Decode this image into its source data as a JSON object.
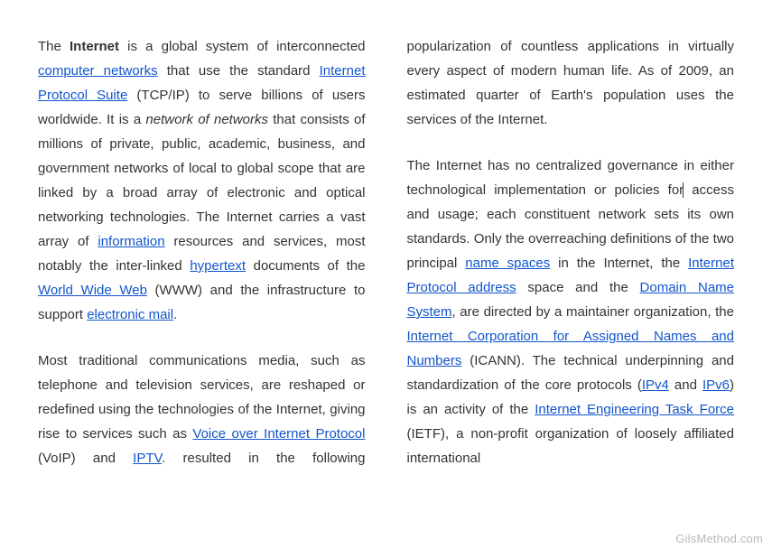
{
  "document": {
    "paragraphs": [
      [
        {
          "t": "The ",
          "s": ""
        },
        {
          "t": "Internet",
          "s": "bold"
        },
        {
          "t": " is a global system of interconnected ",
          "s": ""
        },
        {
          "t": "computer networks",
          "s": "link",
          "name": "link-computer-networks"
        },
        {
          "t": " that use the standard ",
          "s": ""
        },
        {
          "t": "Internet Protocol Suite",
          "s": "link",
          "name": "link-internet-protocol-suite"
        },
        {
          "t": " (TCP/IP) to serve billions of users worldwide. It is a ",
          "s": ""
        },
        {
          "t": "network of networks",
          "s": "italic"
        },
        {
          "t": " that consists of millions of private, public, academic, business, and government networks of local to global scope that are linked by a broad array of electronic and optical networking technologies. The Internet carries a vast array of ",
          "s": ""
        },
        {
          "t": "information",
          "s": "link",
          "name": "link-information"
        },
        {
          "t": " resources and services, most notably the inter-linked ",
          "s": ""
        },
        {
          "t": "hypertext",
          "s": "link",
          "name": "link-hypertext"
        },
        {
          "t": " documents of the ",
          "s": ""
        },
        {
          "t": "World Wide Web",
          "s": "link",
          "name": "link-world-wide-web"
        },
        {
          "t": " (WWW) and the infrastructure to support ",
          "s": ""
        },
        {
          "t": "electronic mail",
          "s": "link",
          "name": "link-electronic-mail"
        },
        {
          "t": ".",
          "s": ""
        }
      ],
      [
        {
          "t": "Most traditional communications media, such as telephone and television services, are reshaped or redefined using the technologies of the Internet, giving rise to services such as ",
          "s": ""
        },
        {
          "t": "Voice over Internet Protocol",
          "s": "link",
          "name": "link-voip"
        },
        {
          "t": " (VoIP) and ",
          "s": ""
        },
        {
          "t": "IPTV",
          "s": "link",
          "name": "link-iptv"
        },
        {
          "t": ". ",
          "s": ""
        },
        {
          "t": "resulted in the following popularization of countless applications in virtually every aspect of modern human life. As of 2009, an estimated quarter of Earth's population uses the services of the Internet.",
          "s": ""
        }
      ],
      [
        {
          "t": "The Internet has no centralized governance in either technological implementation or policies for",
          "s": ""
        },
        {
          "t": "",
          "s": "caret"
        },
        {
          "t": " access and usage; each constituent network sets its own standards. Only the overreaching definitions of the two principal ",
          "s": ""
        },
        {
          "t": "name spaces",
          "s": "link",
          "name": "link-name-spaces"
        },
        {
          "t": " in the Internet, the ",
          "s": ""
        },
        {
          "t": "Internet Protocol address",
          "s": "link",
          "name": "link-ip-address"
        },
        {
          "t": " space and the ",
          "s": ""
        },
        {
          "t": "Domain Name System",
          "s": "link",
          "name": "link-dns"
        },
        {
          "t": ", are directed by a maintainer organization, the ",
          "s": ""
        },
        {
          "t": "Internet Corporation for Assigned Names and Numbers",
          "s": "link",
          "name": "link-icann"
        },
        {
          "t": " (ICANN). The technical underpinning and standardization of the core protocols (",
          "s": ""
        },
        {
          "t": "IPv4",
          "s": "link",
          "name": "link-ipv4"
        },
        {
          "t": " and ",
          "s": ""
        },
        {
          "t": "IPv6",
          "s": "link",
          "name": "link-ipv6"
        },
        {
          "t": ") is an activity of the ",
          "s": ""
        },
        {
          "t": "Internet Engineering Task Force",
          "s": "link",
          "name": "link-ietf"
        },
        {
          "t": " (IETF), a non-profit organization of loosely affiliated international ",
          "s": ""
        }
      ]
    ]
  },
  "watermark": "GilsMethod.com"
}
